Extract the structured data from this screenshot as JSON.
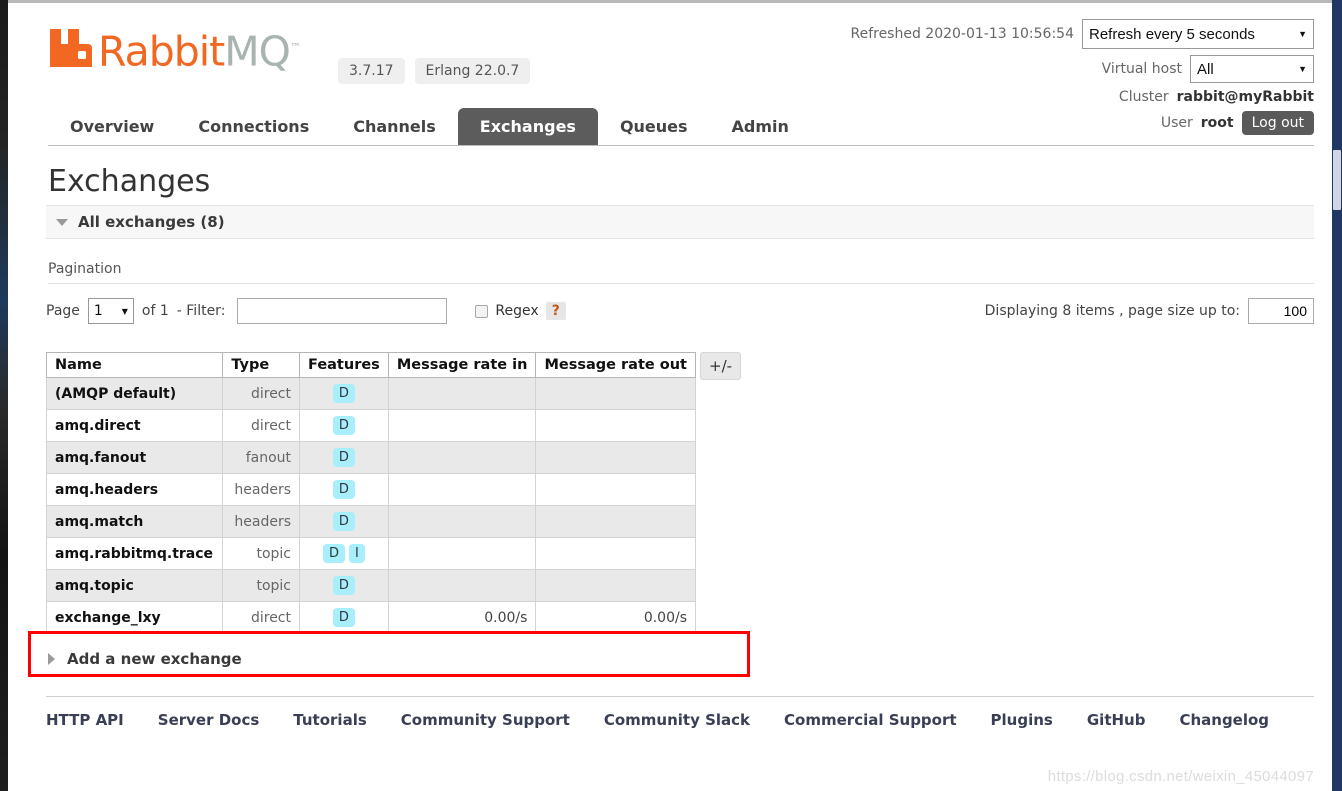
{
  "brand": {
    "name_rabbit": "Rabbit",
    "name_mq": "MQ",
    "tm": "™",
    "version": "3.7.17",
    "erlang": "Erlang 22.0.7"
  },
  "header": {
    "refreshed_text": "Refreshed 2020-01-13 10:56:54",
    "refresh_select": "Refresh every 5 seconds",
    "vhost_label": "Virtual host",
    "vhost_select": "All",
    "cluster_label": "Cluster",
    "cluster_name": "rabbit@myRabbit",
    "user_label": "User",
    "user_name": "root",
    "logout_label": "Log out",
    "caret": "▼"
  },
  "nav": {
    "tabs": [
      {
        "label": "Overview",
        "active": false
      },
      {
        "label": "Connections",
        "active": false
      },
      {
        "label": "Channels",
        "active": false
      },
      {
        "label": "Exchanges",
        "active": true
      },
      {
        "label": "Queues",
        "active": false
      },
      {
        "label": "Admin",
        "active": false
      }
    ]
  },
  "main": {
    "page_title": "Exchanges",
    "section_label": "All exchanges (8)",
    "pagination_label": "Pagination",
    "page_word": "Page",
    "page_value": "1",
    "of_text": "of 1",
    "filter_label": "- Filter:",
    "filter_value": "",
    "filter_placeholder": "",
    "regex_label": "Regex",
    "help_label": "?",
    "displaying_text": "Displaying 8 items , page size up to:",
    "page_size_value": "100"
  },
  "table": {
    "columns": [
      "Name",
      "Type",
      "Features",
      "Message rate in",
      "Message rate out"
    ],
    "plus_minus": "+/-",
    "rows": [
      {
        "name": "(AMQP default)",
        "type": "direct",
        "features": [
          "D"
        ],
        "rate_in": "",
        "rate_out": "",
        "highlighted": false
      },
      {
        "name": "amq.direct",
        "type": "direct",
        "features": [
          "D"
        ],
        "rate_in": "",
        "rate_out": "",
        "highlighted": false
      },
      {
        "name": "amq.fanout",
        "type": "fanout",
        "features": [
          "D"
        ],
        "rate_in": "",
        "rate_out": "",
        "highlighted": false
      },
      {
        "name": "amq.headers",
        "type": "headers",
        "features": [
          "D"
        ],
        "rate_in": "",
        "rate_out": "",
        "highlighted": false
      },
      {
        "name": "amq.match",
        "type": "headers",
        "features": [
          "D"
        ],
        "rate_in": "",
        "rate_out": "",
        "highlighted": false
      },
      {
        "name": "amq.rabbitmq.trace",
        "type": "topic",
        "features": [
          "D",
          "I"
        ],
        "rate_in": "",
        "rate_out": "",
        "highlighted": false
      },
      {
        "name": "amq.topic",
        "type": "topic",
        "features": [
          "D"
        ],
        "rate_in": "",
        "rate_out": "",
        "highlighted": false
      },
      {
        "name": "exchange_lxy",
        "type": "direct",
        "features": [
          "D"
        ],
        "rate_in": "0.00/s",
        "rate_out": "0.00/s",
        "highlighted": true
      }
    ]
  },
  "add_new": {
    "label": "Add a new exchange"
  },
  "footer": {
    "links": [
      "HTTP API",
      "Server Docs",
      "Tutorials",
      "Community Support",
      "Community Slack",
      "Commercial Support",
      "Plugins",
      "GitHub",
      "Changelog"
    ]
  },
  "watermark": "https://blog.csdn.net/weixin_45044097",
  "colors": {
    "brand_orange": "#f26722",
    "brand_gray": "#a9b3b0",
    "active_tab": "#5c5c5c",
    "badge": "#a8eefc",
    "highlight": "#ff0000"
  }
}
